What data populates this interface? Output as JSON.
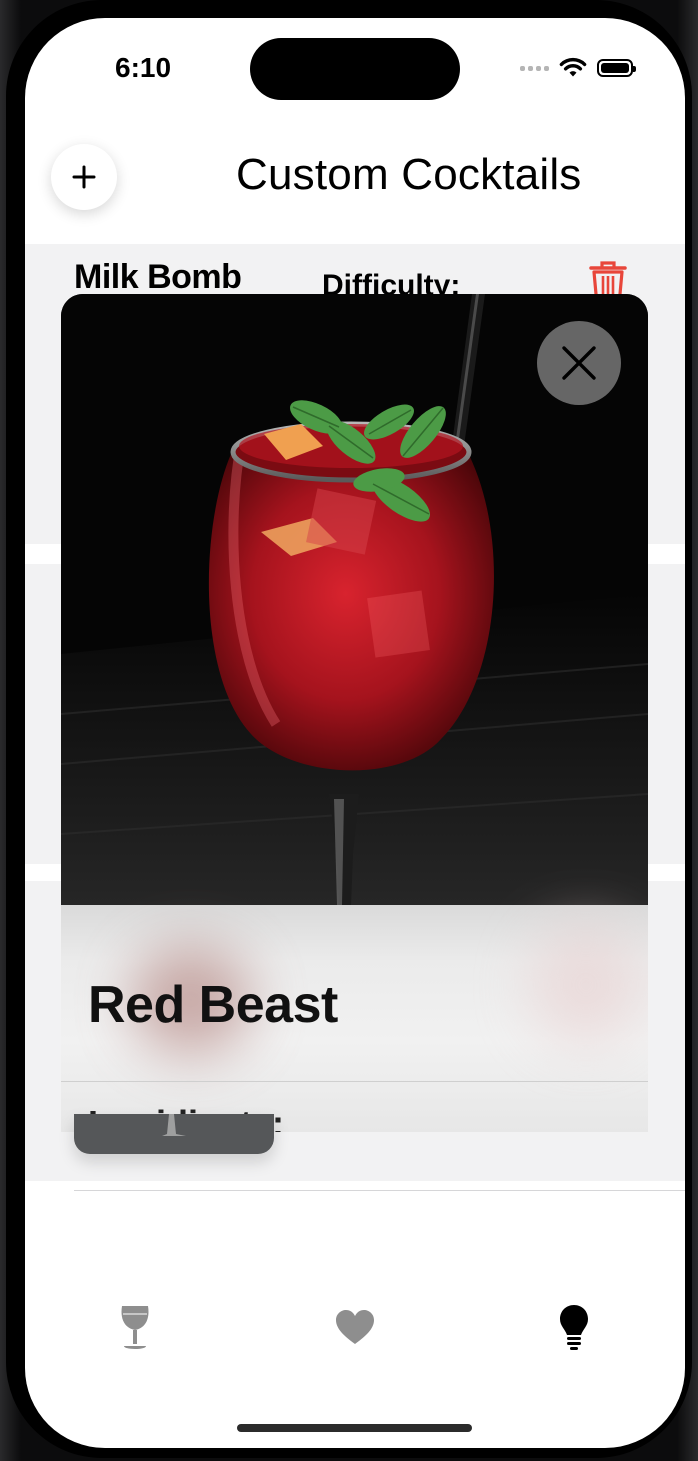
{
  "status": {
    "time": "6:10"
  },
  "header": {
    "title": "Custom Cocktails"
  },
  "background_list": [
    {
      "name": "Milk Bomb",
      "difficulty_label": "Difficulty:"
    }
  ],
  "detail": {
    "name": "Red Beast",
    "ingredients_label": "Ingridients:"
  },
  "icons": {
    "add": "plus-icon",
    "close": "close-icon",
    "delete": "trash-icon",
    "tab1": "wine-glass-icon",
    "tab2": "heart-icon",
    "tab3": "lightbulb-icon"
  },
  "colors": {
    "trash": "#e8463a",
    "tab_inactive": "#8e8e8e",
    "tab_active": "#000000"
  }
}
